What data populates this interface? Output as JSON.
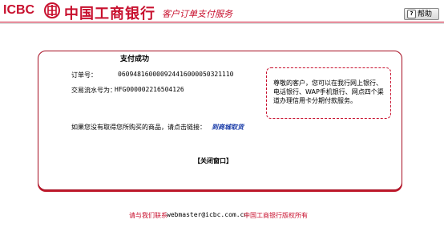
{
  "header": {
    "logo_en": "ICBC",
    "logo_cn": "中国工商银行",
    "subtitle": "客户订单支付服务",
    "help_label": "帮助",
    "brand_color": "#c8102e"
  },
  "payment": {
    "title": "支付成功",
    "order_label": "订单号：",
    "order_value": "060948160000924416000050321110",
    "txn_label": "交易流水号为：",
    "txn_value": "HFG000002216504126",
    "prompt_text": "如果您没有取得您所购买的商品，请点击链接：",
    "prompt_link": "到商城取货",
    "close_label": "【关闭窗口】"
  },
  "notice": {
    "text": "尊敬的客户，您可以在我行网上银行、电话银行、WAP手机银行、网点四个渠道办理信用卡分期付款服务。"
  },
  "footer": {
    "contact": "请与我们联系",
    "email": "webmaster@icbc.com.cn",
    "copyright": "中国工商银行版权所有"
  }
}
